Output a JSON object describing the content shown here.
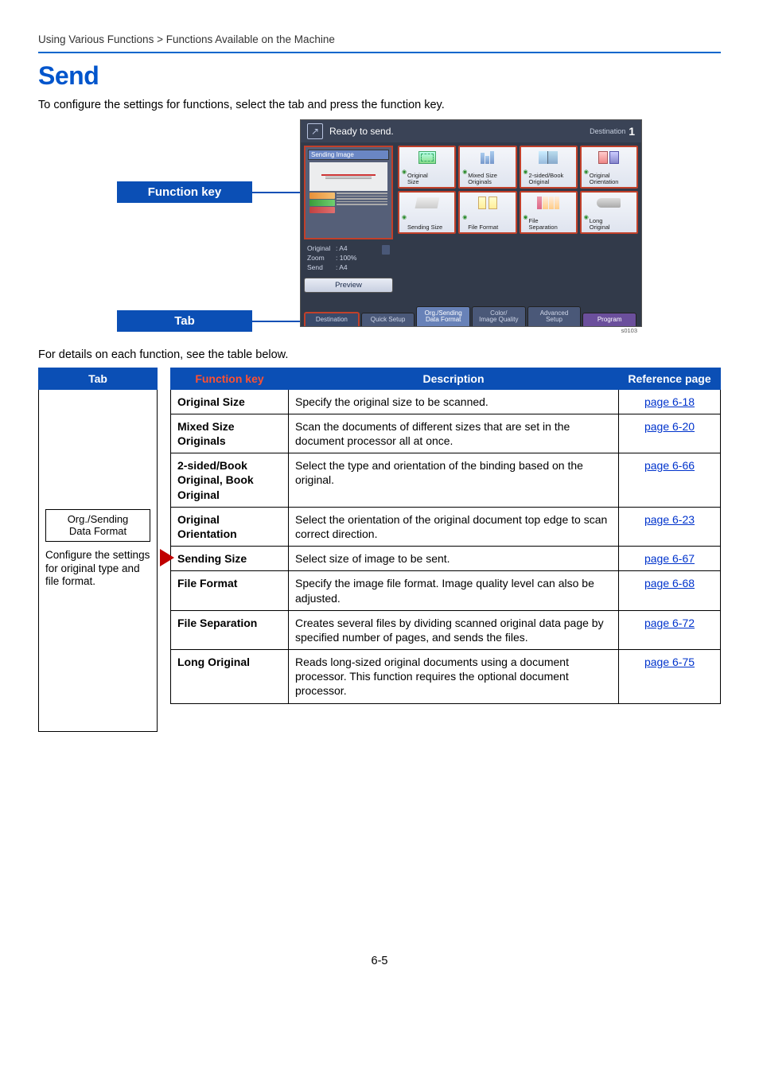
{
  "breadcrumb": "Using Various Functions > Functions Available on the Machine",
  "title": "Send",
  "intro": "To configure the settings for functions, select the tab and press the function key.",
  "subtext": "For details on each function, see the table below.",
  "page_number": "6-5",
  "labels": {
    "function_key": "Function key",
    "tab": "Tab"
  },
  "panel": {
    "header_title": "Ready to send.",
    "header_dest_label": "Destination",
    "header_dest_count": "1",
    "sending_image": "Sending Image",
    "meta": {
      "original_k": "Original",
      "original_v": ": A4",
      "zoom_k": "Zoom",
      "zoom_v": ": 100%",
      "send_k": "Send",
      "send_v": ": A4"
    },
    "preview": "Preview",
    "fn": [
      {
        "label": "Original\nSize"
      },
      {
        "label": "Mixed Size\nOriginals"
      },
      {
        "label": "2-sided/Book\nOriginal"
      },
      {
        "label": "Original\nOrientation"
      },
      {
        "label": "Sending Size"
      },
      {
        "label": "File Format"
      },
      {
        "label": "File\nSeparation"
      },
      {
        "label": "Long\nOriginal"
      }
    ],
    "tabs": [
      "Destination",
      "Quick Setup",
      "Org./Sending\nData Format",
      "Color/\nImage Quality",
      "Advanced\nSetup",
      "Program"
    ],
    "code": "s0103"
  },
  "tab_column": {
    "header": "Tab",
    "box_line1": "Org./Sending",
    "box_line2": "Data Format",
    "desc": "Configure the settings for original type and file format."
  },
  "table": {
    "headers": {
      "fk": "Function key",
      "desc": "Description",
      "ref": "Reference page"
    },
    "rows": [
      {
        "fk": "Original Size",
        "desc": "Specify the original size to be scanned.",
        "ref": "page 6-18"
      },
      {
        "fk": "Mixed Size Originals",
        "desc": "Scan the documents of different sizes that are set in the document processor all at once.",
        "ref": "page 6-20"
      },
      {
        "fk": "2-sided/Book Original, Book Original",
        "desc": "Select the type and orientation of the binding based on the original.",
        "ref": "page 6-66"
      },
      {
        "fk": "Original Orientation",
        "desc": "Select the orientation of the original document top edge to scan correct direction.",
        "ref": "page 6-23"
      },
      {
        "fk": "Sending Size",
        "desc": "Select size of image to be sent.",
        "ref": "page 6-67"
      },
      {
        "fk": "File Format",
        "desc": "Specify the image file format. Image quality level can also be adjusted.",
        "ref": "page 6-68"
      },
      {
        "fk": "File Separation",
        "desc": "Creates several files by dividing scanned original data page by specified number of pages, and sends the files.",
        "ref": "page 6-72"
      },
      {
        "fk": "Long Original",
        "desc": "Reads long-sized original documents using a document processor. This function requires the optional document processor.",
        "ref": "page 6-75"
      }
    ]
  }
}
